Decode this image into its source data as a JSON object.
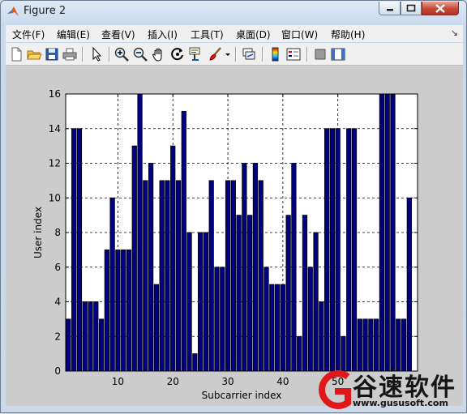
{
  "window": {
    "title": "Figure 2",
    "title_icon": "matlab-icon",
    "controls": [
      "minimize-icon",
      "maximize-icon",
      "close-icon"
    ]
  },
  "menu": {
    "items": [
      "文件(F)",
      "编辑(E)",
      "查看(V)",
      "插入(I)",
      "工具(T)",
      "桌面(D)",
      "窗口(W)",
      "帮助(H)"
    ]
  },
  "toolbar": {
    "icons": [
      "new-figure-icon",
      "open-file-icon",
      "save-icon",
      "print-icon",
      "edit-plot-arrow-icon",
      "zoom-in-icon",
      "zoom-out-icon",
      "pan-hand-icon",
      "rotate-3d-icon",
      "data-cursor-icon",
      "brush-icon",
      "brush-dropdown-icon",
      "link-plot-icon",
      "colorbar-icon",
      "legend-icon",
      "hide-plot-tools-icon",
      "show-plot-tools-icon"
    ]
  },
  "colors": {
    "bar_fill": "#000080",
    "figure_bg": "#cccccc",
    "axes_bg": "#ffffff"
  },
  "chart_data": {
    "type": "bar",
    "title": "",
    "xlabel": "Subcarrier index",
    "ylabel": "User index",
    "x": [
      1,
      2,
      3,
      4,
      5,
      6,
      7,
      8,
      9,
      10,
      11,
      12,
      13,
      14,
      15,
      16,
      17,
      18,
      19,
      20,
      21,
      22,
      23,
      24,
      25,
      26,
      27,
      28,
      29,
      30,
      31,
      32,
      33,
      34,
      35,
      36,
      37,
      38,
      39,
      40,
      41,
      42,
      43,
      44,
      45,
      46,
      47,
      48,
      49,
      50,
      51,
      52,
      53,
      54,
      55,
      56,
      57,
      58,
      59,
      60,
      61,
      62,
      63,
      64
    ],
    "values": [
      3,
      14,
      14,
      4,
      4,
      4,
      3,
      7,
      10,
      7,
      7,
      7,
      13,
      16,
      11,
      12,
      5,
      11,
      11,
      13,
      11,
      15,
      8,
      1,
      8,
      8,
      11,
      6,
      6,
      11,
      11,
      9,
      12,
      9,
      12,
      11,
      6,
      5,
      5,
      5,
      9,
      12,
      2,
      9,
      6,
      8,
      4,
      14,
      14,
      14,
      2,
      14,
      14,
      3,
      3,
      3,
      3,
      16,
      16,
      16,
      3,
      3,
      10
    ],
    "xlim": [
      0.5,
      64.5
    ],
    "ylim": [
      0,
      16
    ],
    "xticks": [
      10,
      20,
      30,
      40,
      50,
      60
    ],
    "yticks": [
      0,
      2,
      4,
      6,
      8,
      10,
      12,
      14,
      16
    ],
    "grid": true
  },
  "watermark": {
    "brand": "谷速软件",
    "url": "www.gususoft.com"
  }
}
